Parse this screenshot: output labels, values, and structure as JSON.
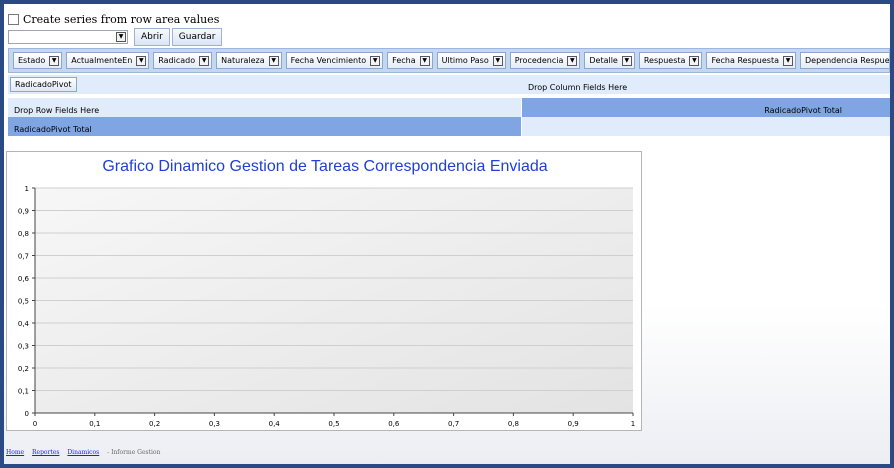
{
  "checkbox": {
    "label": "Create series from row area values",
    "checked": false
  },
  "toolbar": {
    "select_value": "",
    "open_label": "Abrir",
    "save_label": "Guardar"
  },
  "fields": [
    "Estado",
    "ActualmenteEn",
    "Radicado",
    "Naturaleza",
    "Fecha Vencimiento",
    "Fecha",
    "Ultimo Paso",
    "Procedencia",
    "Detalle",
    "Respuesta",
    "Fecha Respuesta",
    "Dependencia Respuesta"
  ],
  "pivot": {
    "data_field": "RadicadoPivot",
    "drop_column": "Drop Column Fields Here",
    "drop_row": "Drop Row Fields Here",
    "column_total": "RadicadoPivot Total",
    "row_total": "RadicadoPivot Total"
  },
  "chart_data": {
    "type": "line",
    "title": "Grafico Dinamico Gestion de Tareas Correspondencia Enviada",
    "xlabel": "",
    "ylabel": "",
    "xlim": [
      0,
      1
    ],
    "ylim": [
      0,
      1
    ],
    "x_ticks": [
      "0",
      "0,1",
      "0,2",
      "0,3",
      "0,4",
      "0,5",
      "0,6",
      "0,7",
      "0,8",
      "0,9",
      "1"
    ],
    "y_ticks": [
      "0",
      "0,1",
      "0,2",
      "0,3",
      "0,4",
      "0,5",
      "0,6",
      "0,7",
      "0,8",
      "0,9",
      "1"
    ],
    "series": [],
    "grid": true,
    "colors": {
      "title": "#1f3fd8",
      "plot_bg": "#ececec",
      "grid": "#cccccc"
    }
  },
  "breadcrumb": {
    "links": [
      "Home",
      "Reportes",
      "Dinamicos"
    ],
    "current": "- Informe Gestion"
  },
  "colors": {
    "border": "#2a4a86",
    "field_bar": "#c4d7f0",
    "pivot_header": "#7fa6e2"
  }
}
